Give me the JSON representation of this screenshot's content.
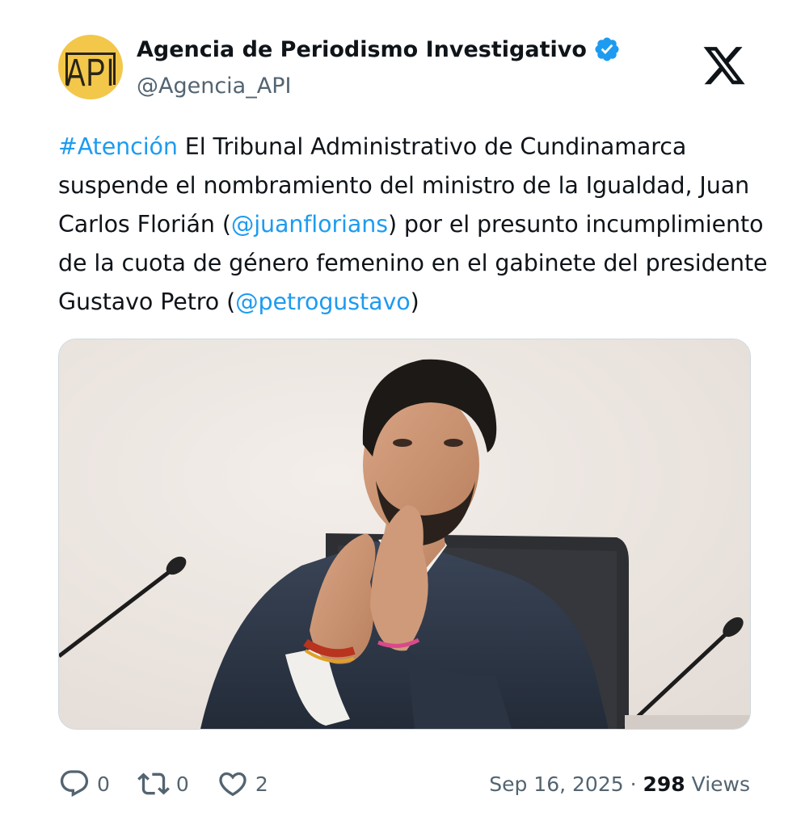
{
  "author": {
    "name": "Agencia de Periodismo Investigativo",
    "handle": "@Agencia_API",
    "avatar_text": "API",
    "verified": true,
    "verified_color": "#1d9bf0",
    "avatar_color": "#f3c74a"
  },
  "platform_logo": "x-logo-icon",
  "tweet": {
    "segments": [
      {
        "text": "#Atención",
        "link": true
      },
      {
        "text": " El Tribunal Administrativo de Cundinamarca suspende el nombramiento del ministro de la Igualdad, Juan Carlos Florián (",
        "link": false
      },
      {
        "text": "@juanflorians",
        "link": true
      },
      {
        "text": ") por el presunto incumplimiento de la cuota de género femenino en el gabinete del presidente Gustavo Petro (",
        "link": false
      },
      {
        "text": "@petrogustavo",
        "link": true
      },
      {
        "text": ")",
        "link": false
      }
    ]
  },
  "media": {
    "type": "photo",
    "icon": "photo-man-clapping"
  },
  "actions": {
    "replies": "0",
    "retweets": "0",
    "likes": "2"
  },
  "meta": {
    "date": "Sep 16, 2025",
    "separator": "·",
    "views_count": "298",
    "views_label": "Views"
  },
  "colors": {
    "link": "#1d9bf0",
    "text": "#0f1419",
    "secondary": "#536471",
    "border": "#cfd9de"
  }
}
